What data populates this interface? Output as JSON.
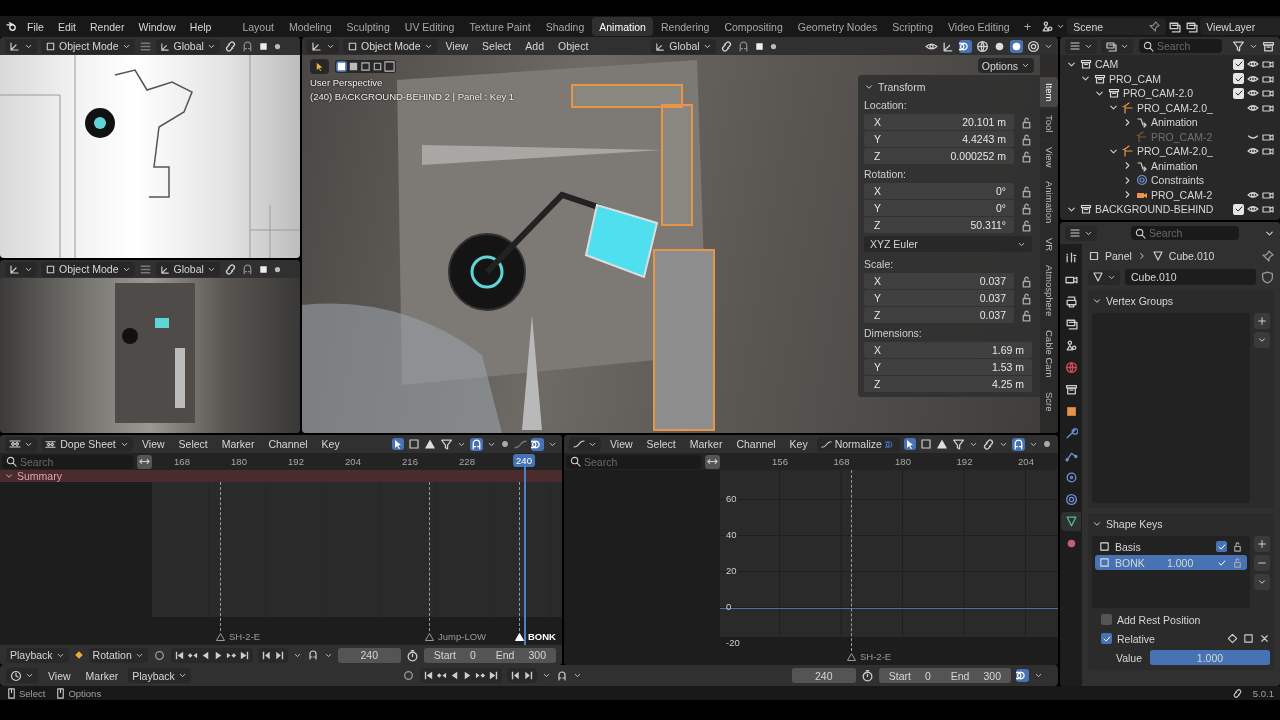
{
  "menu": [
    "File",
    "Edit",
    "Render",
    "Window",
    "Help"
  ],
  "workspaces": [
    {
      "label": "Layout",
      "selected": false
    },
    {
      "label": "Modeling",
      "selected": false
    },
    {
      "label": "Sculpting",
      "selected": false
    },
    {
      "label": "UV Editing",
      "selected": false
    },
    {
      "label": "Texture Paint",
      "selected": false
    },
    {
      "label": "Shading",
      "selected": false
    },
    {
      "label": "Animation",
      "selected": true
    },
    {
      "label": "Rendering",
      "selected": false
    },
    {
      "label": "Compositing",
      "selected": false
    },
    {
      "label": "Geometry Nodes",
      "selected": false
    },
    {
      "label": "Scripting",
      "selected": false
    },
    {
      "label": "Video Editing",
      "selected": false
    }
  ],
  "add_workspace": "+",
  "scene": "Scene",
  "view_layer": "ViewLayer",
  "side_viewports": [
    {
      "mode": "Object Mode",
      "orientation": "Global"
    },
    {
      "mode": "Object Mode",
      "orientation": "Global"
    }
  ],
  "viewport": {
    "mode": "Object Mode",
    "menus": [
      "View",
      "Select",
      "Add",
      "Object"
    ],
    "orientation": "Global",
    "options": "Options",
    "overlay_title": "User Perspective",
    "overlay_info": "(240) BACKGROUND-BEHIND 2 | Panel : Key 1",
    "transform": {
      "title": "Transform",
      "rows": [
        {
          "kind": "label",
          "text": "Location:"
        },
        {
          "kind": "field",
          "axis": "X",
          "value": "20.101 m",
          "lockable": true
        },
        {
          "kind": "field",
          "axis": "Y",
          "value": "4.4243 m",
          "lockable": true
        },
        {
          "kind": "field",
          "axis": "Z",
          "value": "0.000252 m",
          "lockable": true
        },
        {
          "kind": "label",
          "text": "Rotation:"
        },
        {
          "kind": "field",
          "axis": "X",
          "value": "0°",
          "lockable": true
        },
        {
          "kind": "field",
          "axis": "Y",
          "value": "0°",
          "lockable": true
        },
        {
          "kind": "field",
          "axis": "Z",
          "value": "50.311°",
          "lockable": true
        },
        {
          "kind": "dropdown",
          "value": "XYZ Euler"
        },
        {
          "kind": "label",
          "text": "Scale:"
        },
        {
          "kind": "field",
          "axis": "X",
          "value": "0.037",
          "lockable": true
        },
        {
          "kind": "field",
          "axis": "Y",
          "value": "0.037",
          "lockable": true
        },
        {
          "kind": "field",
          "axis": "Z",
          "value": "0.037",
          "lockable": true
        },
        {
          "kind": "label",
          "text": "Dimensions:"
        },
        {
          "kind": "field",
          "axis": "X",
          "value": "1.69 m",
          "lockable": false
        },
        {
          "kind": "field",
          "axis": "Y",
          "value": "1.53 m",
          "lockable": false
        },
        {
          "kind": "field",
          "axis": "Z",
          "value": "4.25 m",
          "lockable": false
        }
      ]
    },
    "tabs": [
      {
        "label": "Item",
        "selected": true
      },
      {
        "label": "Tool",
        "selected": false
      },
      {
        "label": "View",
        "selected": false
      },
      {
        "label": "Animation",
        "selected": false
      },
      {
        "label": "VR",
        "selected": false
      },
      {
        "label": "Atmosphere",
        "selected": false
      },
      {
        "label": "Cable Cam",
        "selected": false
      },
      {
        "label": "Scre",
        "selected": false
      }
    ]
  },
  "outliner": {
    "search_placeholder": "Search",
    "tree": [
      {
        "name": "CAM",
        "kind": "collection",
        "expanded": true,
        "checked": true,
        "visible": true,
        "disabled": false,
        "children": [
          {
            "name": "PRO_CAM",
            "kind": "collection",
            "expanded": true,
            "checked": true,
            "visible": true,
            "disabled": false,
            "children": [
              {
                "name": "PRO_CAM-2.0",
                "kind": "collection",
                "expanded": true,
                "checked": true,
                "visible": true,
                "disabled": false,
                "children": [
                  {
                    "name": "PRO_CAM-2.0_",
                    "kind": "armature",
                    "expanded": true,
                    "visible": true,
                    "disabled": false,
                    "children": [
                      {
                        "name": "Animation",
                        "kind": "animation",
                        "expanded": false,
                        "disabled": false
                      },
                      {
                        "name": "PRO_CAM-2",
                        "kind": "armature",
                        "visible": false,
                        "disabled": true
                      }
                    ]
                  },
                  {
                    "name": "PRO_CAM-2.0_",
                    "kind": "armature",
                    "expanded": true,
                    "visible": true,
                    "disabled": false,
                    "children": [
                      {
                        "name": "Animation",
                        "kind": "animation",
                        "expanded": false,
                        "disabled": false
                      },
                      {
                        "name": "Constraints",
                        "kind": "constraints",
                        "expanded": false,
                        "disabled": false
                      },
                      {
                        "name": "PRO_CAM-2",
                        "kind": "camera",
                        "expanded": false,
                        "visible": true,
                        "disabled": false
                      }
                    ]
                  }
                ]
              }
            ]
          }
        ]
      },
      {
        "name": "BACKGROUND-BEHIND",
        "kind": "collection",
        "expanded": true,
        "checked": true,
        "visible": true,
        "disabled": false
      }
    ]
  },
  "properties": {
    "search_placeholder": "Search",
    "tabs": [
      {
        "kind": "tool",
        "selected": false
      },
      {
        "kind": "render",
        "selected": false
      },
      {
        "kind": "output",
        "selected": false
      },
      {
        "kind": "view_layer",
        "selected": false
      },
      {
        "kind": "scene",
        "selected": false
      },
      {
        "kind": "world",
        "selected": false
      },
      {
        "kind": "collection",
        "selected": false
      },
      {
        "kind": "object",
        "selected": false
      },
      {
        "kind": "modifiers",
        "selected": false
      },
      {
        "kind": "particles",
        "selected": false
      },
      {
        "kind": "physics",
        "selected": false
      },
      {
        "kind": "constraints",
        "selected": false
      },
      {
        "kind": "data",
        "selected": true
      },
      {
        "kind": "material",
        "selected": false
      }
    ],
    "breadcrumb": [
      "Panel",
      "Cube.010"
    ],
    "data_name": "Cube.010",
    "vertex_groups": {
      "title": "Vertex Groups",
      "expanded": true
    },
    "shape_keys": {
      "title": "Shape Keys",
      "expanded": true,
      "keys": [
        {
          "name": "Basis",
          "checked": true,
          "selected": false
        },
        {
          "name": "BONK",
          "value": "1.000",
          "checked": true,
          "selected": true
        }
      ],
      "add_rest_position": {
        "label": "Add Rest Position",
        "checked": false
      },
      "relative": {
        "label": "Relative",
        "checked": true
      },
      "value": {
        "label": "Value",
        "reading": "1.000",
        "level": 1
      }
    }
  },
  "dope_sheet": {
    "mode": "Dope Sheet",
    "menus": [
      "View",
      "Select",
      "Marker",
      "Channel",
      "Key"
    ],
    "search_placeholder": "Search",
    "ticks": [
      "168",
      "180",
      "192",
      "204",
      "216",
      "228"
    ],
    "current_frame": "240",
    "summary": {
      "label": "Summary",
      "expanded": true
    },
    "markers": [
      {
        "name": "SH-2-E",
        "selected": false
      },
      {
        "name": "Jump-LOW",
        "selected": false
      },
      {
        "name": "BONK",
        "selected": true
      }
    ],
    "footer": {
      "playback": "Playback",
      "keying_set": "Rotation",
      "frame": "240",
      "start_label": "Start",
      "start": "0",
      "end_label": "End",
      "end": "300"
    }
  },
  "graph_editor": {
    "menus": [
      "View",
      "Select",
      "Marker",
      "Channel",
      "Key"
    ],
    "normalize": "Normalize",
    "search_placeholder": "Search",
    "x_ticks": [
      "156",
      "168",
      "180",
      "192",
      "204"
    ],
    "y_ticks": [
      "60",
      "40",
      "20",
      "0",
      "-20"
    ],
    "markers": [
      {
        "name": "SH-2-E",
        "selected": false
      }
    ]
  },
  "timeline": {
    "menus": [
      {
        "label": "View",
        "dropdown": false
      },
      {
        "label": "Marker",
        "dropdown": false
      },
      {
        "label": "Playback",
        "dropdown": true
      }
    ],
    "frame": "240",
    "start_label": "Start",
    "start": "0",
    "end_label": "End",
    "end": "300"
  },
  "status_bar": {
    "items": [
      "Select",
      "Options"
    ],
    "version": "5.0.1"
  }
}
